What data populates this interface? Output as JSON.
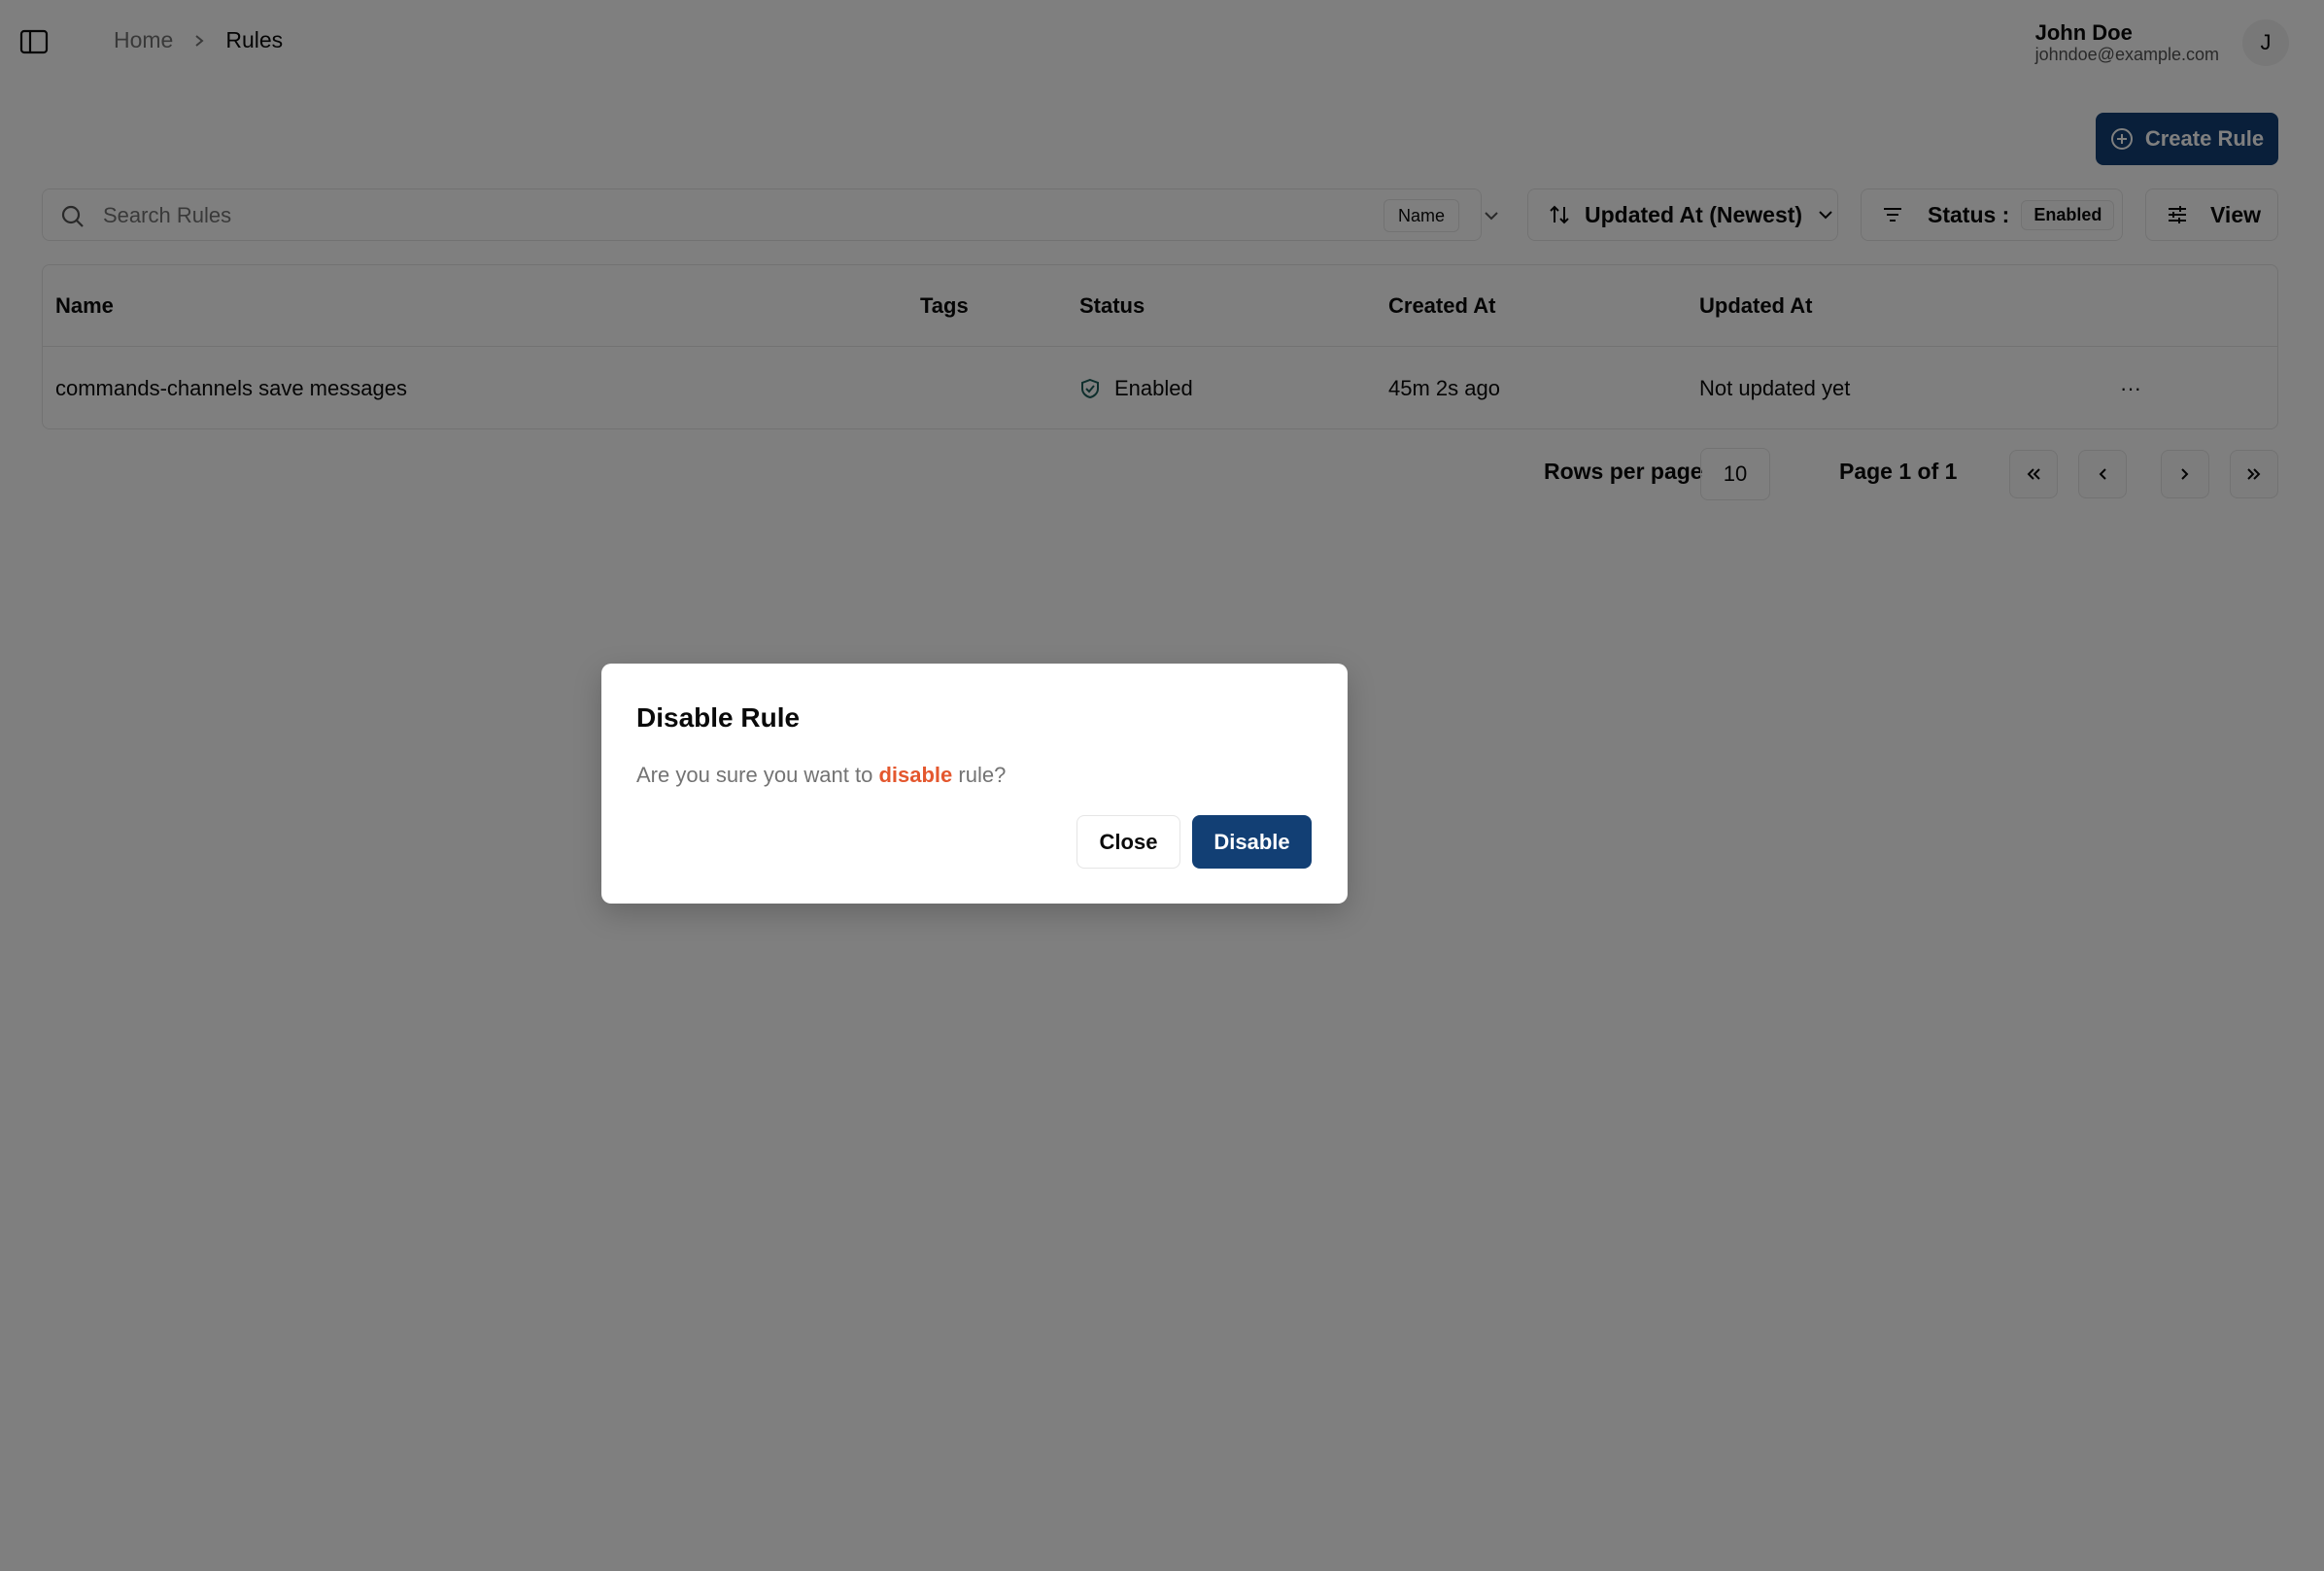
{
  "header": {
    "breadcrumb": {
      "home": "Home",
      "current": "Rules"
    },
    "user": {
      "name": "John Doe",
      "email": "johndoe@example.com",
      "avatar_initial": "J"
    }
  },
  "actions": {
    "create_label": "Create Rule"
  },
  "toolbar": {
    "search_placeholder": "Search Rules",
    "search_field": "Name",
    "sort_label": "Updated At (Newest)",
    "filter_label": "Status :",
    "filter_value": "Enabled",
    "view_label": "View"
  },
  "table": {
    "columns": [
      "Name",
      "Tags",
      "Status",
      "Created At",
      "Updated At"
    ],
    "rows": [
      {
        "name": "commands-channels save messages",
        "tags": "",
        "status": "Enabled",
        "created": "45m 2s ago",
        "updated": "Not updated yet",
        "actions": "···"
      }
    ]
  },
  "pagination": {
    "rows_label": "Rows per page",
    "rows_value": "10",
    "page_label": "Page 1 of 1"
  },
  "dialog": {
    "title": "Disable Rule",
    "text_before": "Are you sure you want to ",
    "text_emph": "disable",
    "text_after": " rule?",
    "close_label": "Close",
    "confirm_label": "Disable"
  },
  "colors": {
    "primary": "#123f74",
    "danger_text": "#e4572e",
    "overlay": "rgba(0,0,0,0.5)"
  },
  "icons": [
    "sidebar-toggle-icon",
    "chevron-right-icon",
    "plus-circle-icon",
    "search-icon",
    "chevron-down-icon",
    "sort-icon",
    "filter-icon",
    "sliders-icon",
    "shield-check-icon",
    "chevrons-left-icon",
    "chevron-left-icon",
    "chevron-right-icon",
    "chevrons-right-icon"
  ]
}
